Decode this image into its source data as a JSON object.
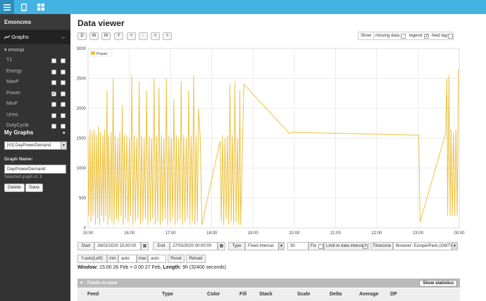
{
  "sidebar": {
    "title": "Emoncms",
    "graphs_label": "Graphs",
    "node": "emonpi",
    "feeds": [
      {
        "name": "T1",
        "checked": false
      },
      {
        "name": "Energy",
        "checked": false
      },
      {
        "name": "MaxP",
        "checked": false
      },
      {
        "name": "Power",
        "checked": true
      },
      {
        "name": "MinP",
        "checked": false
      },
      {
        "name": "Urms",
        "checked": false
      },
      {
        "name": "DutyCycle",
        "checked": false
      }
    ],
    "my_graphs_title": "My Graphs",
    "graph_select": "[#3] DayPowerDemand",
    "graph_name_label": "Graph Name:",
    "graph_name_value": "DayPowerDemand",
    "selected_graph_id": "Selected graph id: 3",
    "delete_label": "Delete",
    "save_label": "Save"
  },
  "main": {
    "title": "Data viewer",
    "range_buttons": [
      "D",
      "W",
      "M",
      "Y",
      "+",
      "-",
      "<",
      ">"
    ],
    "show_label": "Show",
    "missing_data_label": "missing data:",
    "missing_data_checked": false,
    "legend_label": "legend:",
    "legend_checked": true,
    "feed_tag_label": "feed tag:",
    "feed_tag_checked": false
  },
  "controls": {
    "start_label": "Start",
    "start_value": "26/02/2020 15:00:00",
    "end_label": "End",
    "end_value": "27/02/2020 00:00:00",
    "type_label": "Type",
    "type_value": "Fixed Interval",
    "interval_value": "30",
    "fix_label": "Fix",
    "limit_label": "Limit to data interval",
    "limit_checked": true,
    "timezone_label": "Timezone",
    "timezone_value": "Browser: Europe/Paris (GMT+",
    "yaxis_label": "Y-axis(Left):",
    "min_label": "min",
    "min_value": "auto",
    "max_label": "max",
    "max_value": "auto",
    "reset_label": "Reset",
    "reload_label": "Reload"
  },
  "window_info": {
    "label": "Window:",
    "text": "15.00 26 Feb > 0.00 27 Feb,",
    "length_label": "Length:",
    "length_text": "9h (32400 seconds)"
  },
  "feeds_panel": {
    "title": "Feeds in view",
    "show_stats_label": "Show statistics",
    "columns": [
      "Feed",
      "Type",
      "Color",
      "Fill",
      "Stack",
      "Scale",
      "Delta",
      "Average",
      "DP"
    ]
  },
  "icons": {
    "menu": "menu-icon",
    "phone": "phone-icon",
    "dashboard": "dashboard-icon",
    "graph": "graph-icon",
    "calendar": "calendar-icon"
  },
  "colors": {
    "topbar": "#44b3e2",
    "sidebar": "#333333",
    "series": "#edc240"
  },
  "chart_data": {
    "type": "line",
    "series": [
      {
        "name": "Power",
        "color": "#edc240"
      }
    ],
    "x_ticks": [
      "15:00",
      "16:00",
      "17:00",
      "18:00",
      "19:00",
      "20:00",
      "21:00",
      "22:00",
      "23:00",
      "00:00"
    ],
    "y_ticks": [
      "0",
      "500",
      "1000",
      "1500",
      "2000",
      "2500",
      "3000"
    ],
    "ylim": [
      0,
      3000
    ],
    "xlim_hours": [
      15,
      24
    ],
    "legend": "top-left",
    "grid": true,
    "points": [
      [
        15.0,
        1550
      ],
      [
        15.02,
        200
      ],
      [
        15.05,
        1650
      ],
      [
        15.07,
        100
      ],
      [
        15.1,
        1600
      ],
      [
        15.12,
        200
      ],
      [
        15.15,
        1650
      ],
      [
        15.18,
        50
      ],
      [
        15.2,
        1550
      ],
      [
        15.23,
        150
      ],
      [
        15.25,
        1700
      ],
      [
        15.28,
        50
      ],
      [
        15.3,
        1600
      ],
      [
        15.33,
        200
      ],
      [
        15.36,
        1550
      ],
      [
        15.38,
        100
      ],
      [
        15.4,
        1650
      ],
      [
        15.43,
        200
      ],
      [
        15.46,
        2300
      ],
      [
        15.48,
        50
      ],
      [
        15.5,
        1550
      ],
      [
        15.53,
        150
      ],
      [
        15.56,
        1600
      ],
      [
        15.58,
        100
      ],
      [
        15.61,
        2500
      ],
      [
        15.63,
        50
      ],
      [
        15.66,
        1550
      ],
      [
        15.69,
        150
      ],
      [
        15.72,
        1500
      ],
      [
        15.74,
        100
      ],
      [
        15.77,
        1600
      ],
      [
        15.8,
        200
      ],
      [
        15.83,
        2050
      ],
      [
        15.85,
        50
      ],
      [
        15.88,
        1550
      ],
      [
        15.91,
        150
      ],
      [
        15.94,
        1550
      ],
      [
        15.97,
        100
      ],
      [
        16.0,
        1500
      ],
      [
        16.03,
        200
      ],
      [
        16.06,
        2550
      ],
      [
        16.09,
        50
      ],
      [
        16.12,
        1550
      ],
      [
        16.15,
        100
      ],
      [
        16.18,
        1500
      ],
      [
        16.21,
        150
      ],
      [
        16.24,
        2450
      ],
      [
        16.27,
        50
      ],
      [
        16.3,
        1550
      ],
      [
        16.33,
        100
      ],
      [
        16.36,
        1500
      ],
      [
        16.39,
        150
      ],
      [
        16.42,
        2300
      ],
      [
        16.45,
        50
      ],
      [
        16.48,
        1550
      ],
      [
        16.51,
        100
      ],
      [
        16.54,
        1500
      ],
      [
        16.57,
        150
      ],
      [
        16.6,
        2500
      ],
      [
        16.63,
        50
      ],
      [
        16.66,
        1550
      ],
      [
        16.69,
        100
      ],
      [
        16.72,
        2350
      ],
      [
        16.75,
        50
      ],
      [
        16.78,
        1550
      ],
      [
        16.81,
        100
      ],
      [
        16.84,
        1500
      ],
      [
        16.87,
        150
      ],
      [
        16.9,
        2500
      ],
      [
        16.93,
        50
      ],
      [
        16.96,
        1550
      ],
      [
        16.99,
        100
      ],
      [
        17.02,
        1500
      ],
      [
        17.05,
        150
      ],
      [
        17.08,
        2150
      ],
      [
        17.11,
        50
      ],
      [
        17.14,
        1550
      ],
      [
        17.17,
        100
      ],
      [
        17.2,
        1500
      ],
      [
        17.23,
        150
      ],
      [
        17.26,
        2450
      ],
      [
        17.29,
        50
      ],
      [
        17.32,
        1550
      ],
      [
        17.35,
        100
      ],
      [
        17.38,
        1500
      ],
      [
        17.41,
        150
      ],
      [
        17.44,
        2300
      ],
      [
        17.47,
        50
      ],
      [
        17.5,
        1550
      ],
      [
        17.53,
        100
      ],
      [
        17.56,
        2550
      ],
      [
        17.59,
        50
      ],
      [
        17.62,
        1550
      ],
      [
        17.65,
        100
      ],
      [
        17.68,
        2000
      ],
      [
        17.72,
        1500
      ],
      [
        17.76,
        50
      ],
      [
        18.2,
        1450
      ],
      [
        18.23,
        100
      ],
      [
        18.26,
        1550
      ],
      [
        18.29,
        50
      ],
      [
        18.32,
        1500
      ],
      [
        18.35,
        150
      ],
      [
        18.38,
        1550
      ],
      [
        18.41,
        50
      ],
      [
        18.44,
        2400
      ],
      [
        18.47,
        100
      ],
      [
        18.5,
        1550
      ],
      [
        18.53,
        50
      ],
      [
        18.56,
        2450
      ],
      [
        18.59,
        100
      ],
      [
        18.62,
        1500
      ],
      [
        18.65,
        50
      ],
      [
        18.68,
        2300
      ],
      [
        18.7,
        50
      ],
      [
        18.78,
        2400
      ],
      [
        19.88,
        1580
      ],
      [
        19.95,
        1600
      ],
      [
        23.02,
        1550
      ],
      [
        23.05,
        100
      ],
      [
        23.67,
        1580
      ],
      [
        23.7,
        2500
      ],
      [
        23.72,
        200
      ],
      [
        23.75,
        2550
      ],
      [
        23.78,
        200
      ],
      [
        23.8,
        1650
      ],
      [
        23.83,
        200
      ],
      [
        23.86,
        1600
      ],
      [
        23.89,
        200
      ],
      [
        23.92,
        1650
      ],
      [
        23.95,
        200
      ],
      [
        23.98,
        2650
      ]
    ]
  }
}
